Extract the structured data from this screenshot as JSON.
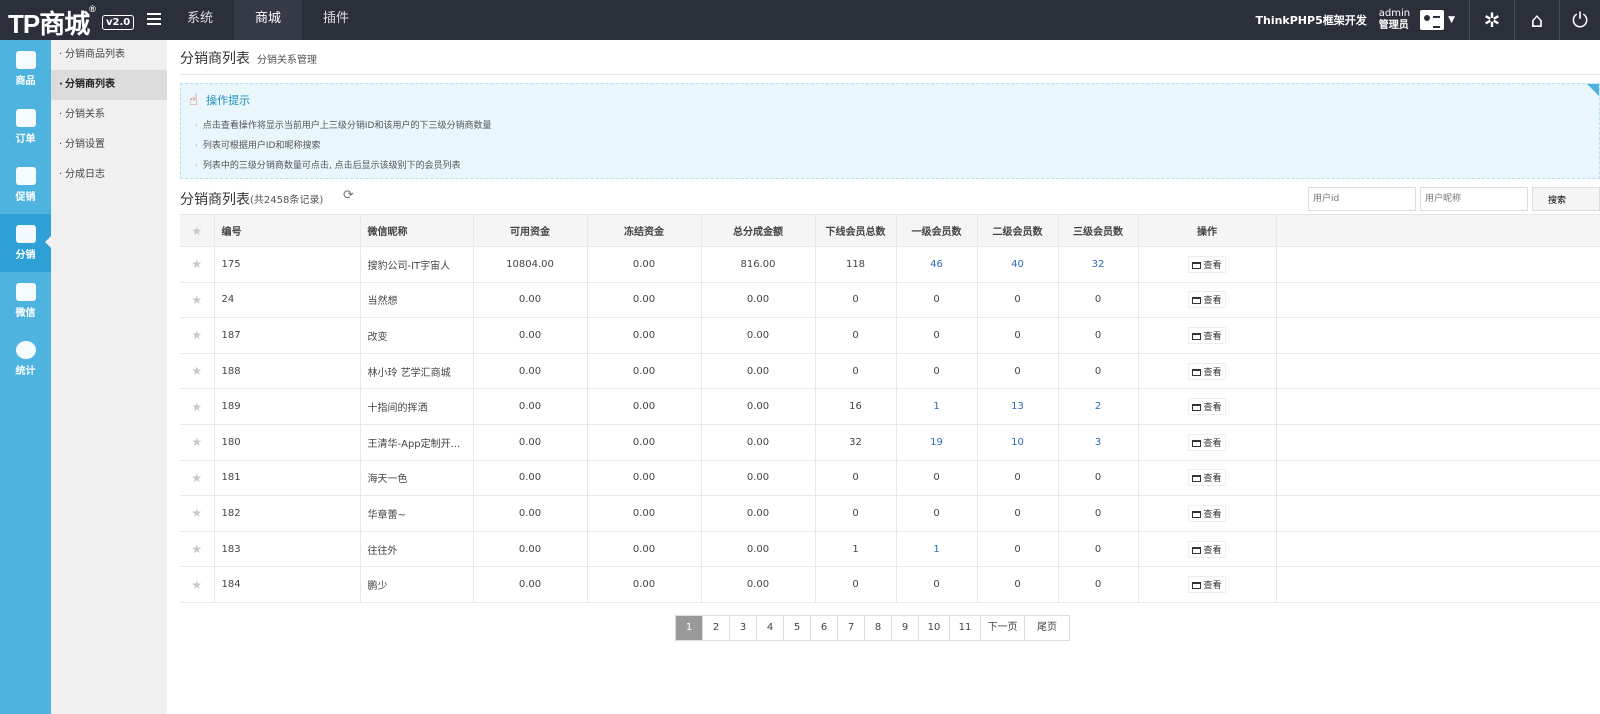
{
  "topbar": {
    "logo": "TP商城",
    "version": "v2.0",
    "nav": [
      "系统",
      "商城",
      "插件"
    ],
    "brand": "ThinkPHP5框架开发",
    "user": {
      "name": "admin",
      "role": "管理员"
    }
  },
  "leftbar": [
    "商品",
    "订单",
    "促销",
    "分销",
    "微信",
    "统计"
  ],
  "subnav": [
    "分销商品列表",
    "分销商列表",
    "分销关系",
    "分销设置",
    "分成日志"
  ],
  "page": {
    "title": "分销商列表",
    "subtitle": "分销关系管理"
  },
  "tips": {
    "title": "操作提示",
    "items": [
      "点击查看操作将显示当前用户上三级分销ID和该用户的下三级分销商数量",
      "列表可根据用户ID和昵称搜索",
      "列表中的三级分销商数量可点击, 点击后显示该级别下的会员列表"
    ]
  },
  "list": {
    "title": "分销商列表",
    "count": "(共2458条记录)"
  },
  "search": {
    "uid_placeholder": "用户id",
    "nick_placeholder": "用户昵称",
    "button": "搜索"
  },
  "table": {
    "headers": [
      "编号",
      "微信昵称",
      "可用资金",
      "冻结资金",
      "总分成金额",
      "下线会员总数",
      "一级会员数",
      "二级会员数",
      "三级会员数",
      "操作"
    ],
    "view_label": "查看",
    "rows": [
      [
        "175",
        "搜豹公司-IT宇宙人",
        "10804.00",
        "0.00",
        "816.00",
        "118",
        "46",
        "40",
        "32"
      ],
      [
        "24",
        "当然想",
        "0.00",
        "0.00",
        "0.00",
        "0",
        "0",
        "0",
        "0"
      ],
      [
        "187",
        "改变",
        "0.00",
        "0.00",
        "0.00",
        "0",
        "0",
        "0",
        "0"
      ],
      [
        "188",
        "林小玲 艺学汇商城",
        "0.00",
        "0.00",
        "0.00",
        "0",
        "0",
        "0",
        "0"
      ],
      [
        "189",
        "十指间的挥洒",
        "0.00",
        "0.00",
        "0.00",
        "16",
        "1",
        "13",
        "2"
      ],
      [
        "180",
        "王清华-App定制开...",
        "0.00",
        "0.00",
        "0.00",
        "32",
        "19",
        "10",
        "3"
      ],
      [
        "181",
        "海天一色",
        "0.00",
        "0.00",
        "0.00",
        "0",
        "0",
        "0",
        "0"
      ],
      [
        "182",
        "华章蕾~",
        "0.00",
        "0.00",
        "0.00",
        "0",
        "0",
        "0",
        "0"
      ],
      [
        "183",
        "往往外",
        "0.00",
        "0.00",
        "0.00",
        "1",
        "1",
        "0",
        "0"
      ],
      [
        "184",
        "鹏少",
        "0.00",
        "0.00",
        "0.00",
        "0",
        "0",
        "0",
        "0"
      ]
    ]
  },
  "pager": [
    "1",
    "2",
    "3",
    "4",
    "5",
    "6",
    "7",
    "8",
    "9",
    "10",
    "11",
    "下一页",
    "尾页"
  ],
  "colors": {
    "topbar": "#2b2f3a",
    "sidebar": "#4fb3e0",
    "link": "#2b6db3",
    "tips_bg": "#e9f6fc"
  }
}
